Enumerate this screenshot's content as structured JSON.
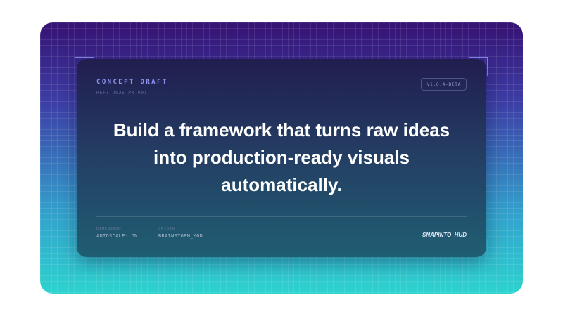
{
  "card": {
    "kicker": "CONCEPT DRAFT",
    "ref": "REF: 2025-PX-001",
    "version": "V1.0.4-BETA",
    "headline": "Build a framework that turns raw ideas into production-ready visuals automatically.",
    "meta": [
      {
        "label": "DIMENSION",
        "value": "AUTOSCALE: ON"
      },
      {
        "label": "ORIGIN",
        "value": "BRAINSTORM_MOD"
      }
    ],
    "brand": "SNAPINTO_HUD"
  },
  "colors": {
    "background_top": "#361273",
    "background_bottom": "#2ed3cf",
    "card_top": "#211d4f",
    "card_bottom": "#1f5e72",
    "accent": "#8f93f2",
    "text": "#ffffff"
  }
}
